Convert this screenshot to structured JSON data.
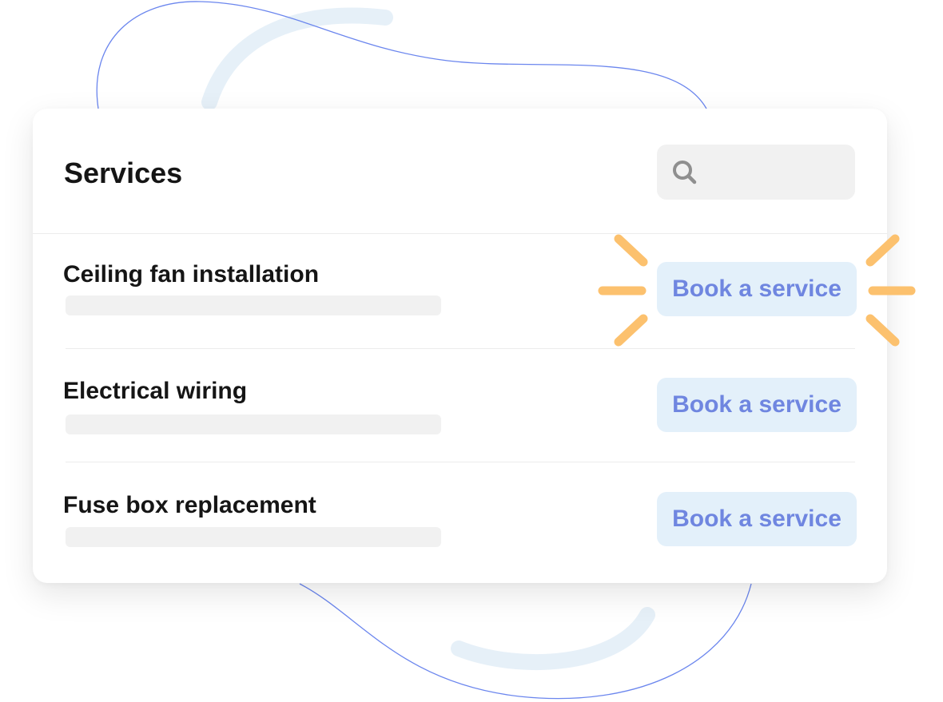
{
  "header": {
    "title": "Services",
    "search_placeholder": ""
  },
  "services": [
    {
      "title": "Ceiling fan installation",
      "button_label": "Book a service",
      "highlighted": true
    },
    {
      "title": "Electrical wiring",
      "button_label": "Book a service",
      "highlighted": false
    },
    {
      "title": "Fuse box replacement",
      "button_label": "Book a service",
      "highlighted": false
    }
  ],
  "colors": {
    "button_bg": "#e3f0fa",
    "button_text": "#6f86e0",
    "sparkle": "#fcc16e",
    "decor_line": "#6b86ee",
    "decor_arc": "#e6f0f8"
  },
  "icons": {
    "search": "search-icon",
    "sparkle": "sparkle-rays"
  }
}
